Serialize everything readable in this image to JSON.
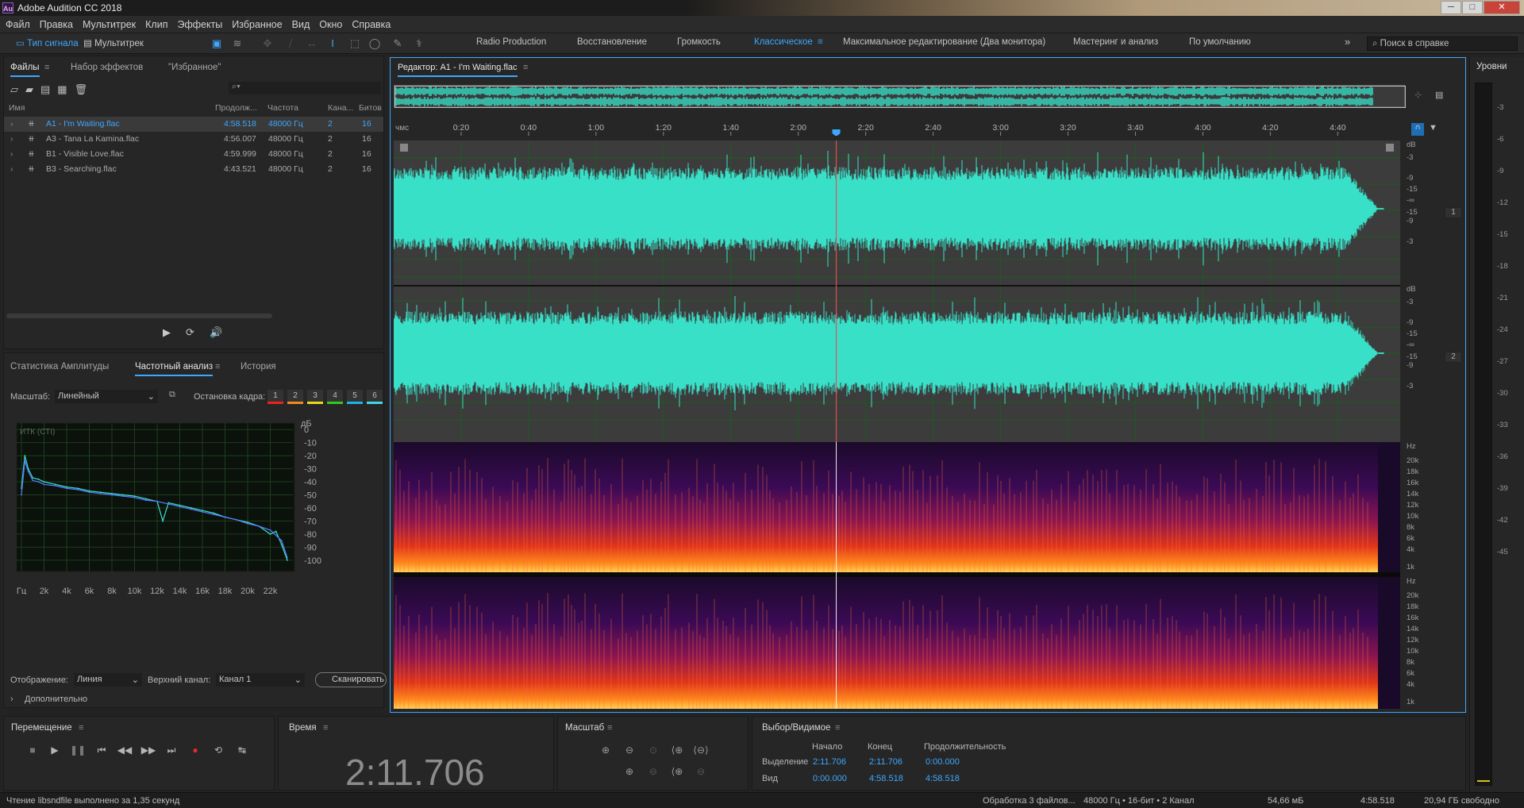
{
  "app": {
    "title": "Adobe Audition CC 2018",
    "logo": "Au"
  },
  "window_controls": [
    "─",
    "□",
    "✕"
  ],
  "menu": [
    "Файл",
    "Правка",
    "Мультитрек",
    "Клип",
    "Эффекты",
    "Избранное",
    "Вид",
    "Окно",
    "Справка"
  ],
  "toolbar": {
    "view_waveform": "Тип сигнала",
    "view_multitrack": "Мультитрек",
    "workspaces": [
      "Radio Production",
      "Восстановление",
      "Громкость",
      "Классическое",
      "Максимальное редактирование (Два монитора)",
      "Мастеринг и анализ",
      "По умолчанию"
    ],
    "active_workspace": "Классическое",
    "more": "»",
    "help_placeholder": "Поиск в справке"
  },
  "files_panel": {
    "tabs": [
      "Файлы",
      "Набор эффектов",
      "\"Избранное\""
    ],
    "columns": [
      "Имя",
      "Продолж...",
      "Частота",
      "Кана...",
      "Битов"
    ],
    "rows": [
      {
        "name": "A1 - I'm Waiting.flac",
        "duration": "4:58.518",
        "rate": "48000 Гц",
        "ch": "2",
        "bits": "16",
        "selected": true
      },
      {
        "name": "A3 - Tana La Kamina.flac",
        "duration": "4:56.007",
        "rate": "48000 Гц",
        "ch": "2",
        "bits": "16",
        "selected": false
      },
      {
        "name": "B1 - Visible Love.flac",
        "duration": "4:59.999",
        "rate": "48000 Гц",
        "ch": "2",
        "bits": "16",
        "selected": false
      },
      {
        "name": "B3 - Searching.flac",
        "duration": "4:43.521",
        "rate": "48000 Гц",
        "ch": "2",
        "bits": "16",
        "selected": false
      }
    ]
  },
  "analysis_panel": {
    "tabs": [
      "Статистика Амплитуды",
      "Частотный анализ",
      "История"
    ],
    "scale_label": "Масштаб:",
    "scale_value": "Линейный",
    "freeze_label": "Остановка кадра:",
    "freeze_slots": [
      "1",
      "2",
      "3",
      "4",
      "5",
      "6"
    ],
    "freeze_colors": [
      "#e8241c",
      "#f08a1c",
      "#e8d81c",
      "#34c81c",
      "#1cb4e8",
      "#3cd8e8"
    ],
    "chart_corner": "ИТК (СТI)",
    "display_label": "Отображение:",
    "display_value": "Линия",
    "top_channel_label": "Верхний канал:",
    "top_channel_value": "Канал 1",
    "scan_btn": "Сканировать",
    "advanced": "Дополнительно"
  },
  "chart_data": {
    "type": "line",
    "title": "",
    "xlabel": "",
    "ylabel": "дБ",
    "x_ticks": [
      "Гц",
      "2k",
      "4k",
      "6k",
      "8k",
      "10k",
      "12k",
      "14k",
      "16k",
      "18k",
      "20k",
      "22k"
    ],
    "y_ticks": [
      "0",
      "-10",
      "-20",
      "-30",
      "-40",
      "-50",
      "-60",
      "-70",
      "-80",
      "-90",
      "-100"
    ],
    "xlim": [
      0,
      24000
    ],
    "ylim": [
      -105,
      5
    ],
    "grid": true,
    "series": [
      {
        "color": "#3be0d0",
        "x": [
          0,
          300,
          600,
          1000,
          1500,
          2000,
          3000,
          4000,
          5000,
          6000,
          7000,
          8000,
          9000,
          10000,
          11000,
          12000,
          12500,
          13000,
          14000,
          15000,
          16000,
          17000,
          18000,
          19000,
          20000,
          21000,
          22000,
          22500,
          23000,
          23500
        ],
        "y": [
          -45,
          -20,
          -30,
          -37,
          -38,
          -40,
          -42,
          -44,
          -45,
          -47,
          -48,
          -49,
          -50,
          -51,
          -53,
          -55,
          -70,
          -56,
          -58,
          -60,
          -62,
          -64,
          -67,
          -69,
          -71,
          -74,
          -80,
          -78,
          -88,
          -100
        ]
      },
      {
        "color": "#5a7bff",
        "x": [
          0,
          300,
          600,
          1000,
          1500,
          2000,
          3000,
          4000,
          5000,
          6000,
          7000,
          8000,
          9000,
          10000,
          11000,
          12000,
          13000,
          14000,
          15000,
          16000,
          17000,
          18000,
          19000,
          20000,
          21000,
          22000,
          23000,
          23500
        ],
        "y": [
          -50,
          -24,
          -32,
          -39,
          -40,
          -42,
          -43,
          -45,
          -46,
          -48,
          -49,
          -50,
          -51,
          -52,
          -54,
          -55,
          -57,
          -59,
          -61,
          -63,
          -65,
          -67,
          -69,
          -72,
          -74,
          -77,
          -85,
          -98
        ]
      }
    ]
  },
  "editor": {
    "title": "Редактор: A1 - I'm Waiting.flac",
    "time_unit": "чмс",
    "ruler": [
      "0:20",
      "0:40",
      "1:00",
      "1:20",
      "1:40",
      "2:00",
      "2:20",
      "2:40",
      "3:00",
      "3:20",
      "3:40",
      "4:00",
      "4:20",
      "4:40"
    ],
    "db_labels_1": [
      "dB",
      "-3",
      "-9",
      "-15",
      "-∞",
      "-15",
      "-9",
      "-3"
    ],
    "db_labels_2": [
      "dB",
      "-3",
      "-9",
      "-15",
      "-∞",
      "-15",
      "-9",
      "-3"
    ],
    "hz_labels": [
      "Hz",
      "20k",
      "18k",
      "16k",
      "14k",
      "12k",
      "10k",
      "8k",
      "6k",
      "4k",
      "1k"
    ],
    "channel_1": "1",
    "channel_2": "2",
    "waveform_color": "#38e0c8",
    "playhead_fraction": 0.4397
  },
  "levels": {
    "title": "Уровни",
    "ticks": [
      "-3",
      "-6",
      "-9",
      "-12",
      "-15",
      "-18",
      "-21",
      "-24",
      "-27",
      "-30",
      "-33",
      "-36",
      "-39",
      "-42",
      "-45"
    ]
  },
  "transport": {
    "title": "Перемещение"
  },
  "time": {
    "title": "Время",
    "value": "2:11.706"
  },
  "zoom": {
    "title": "Масштаб"
  },
  "selection": {
    "title": "Выбор/Видимое",
    "headers": [
      "Начало",
      "Конец",
      "Продолжительность"
    ],
    "rows": [
      {
        "label": "Выделение",
        "start": "2:11.706",
        "end": "2:11.706",
        "dur": "0:00.000"
      },
      {
        "label": "Вид",
        "start": "0:00.000",
        "end": "4:58.518",
        "dur": "4:58.518"
      }
    ]
  },
  "status": {
    "left": "Чтение libsndfile выполнено за 1,35 секунд",
    "processing": "Обработка 3 файлов...",
    "format": "48000 Гц • 16-бит • 2 Канал",
    "size": "54,66 мБ",
    "duration": "4:58.518",
    "free": "20,94 ГБ свободно"
  }
}
